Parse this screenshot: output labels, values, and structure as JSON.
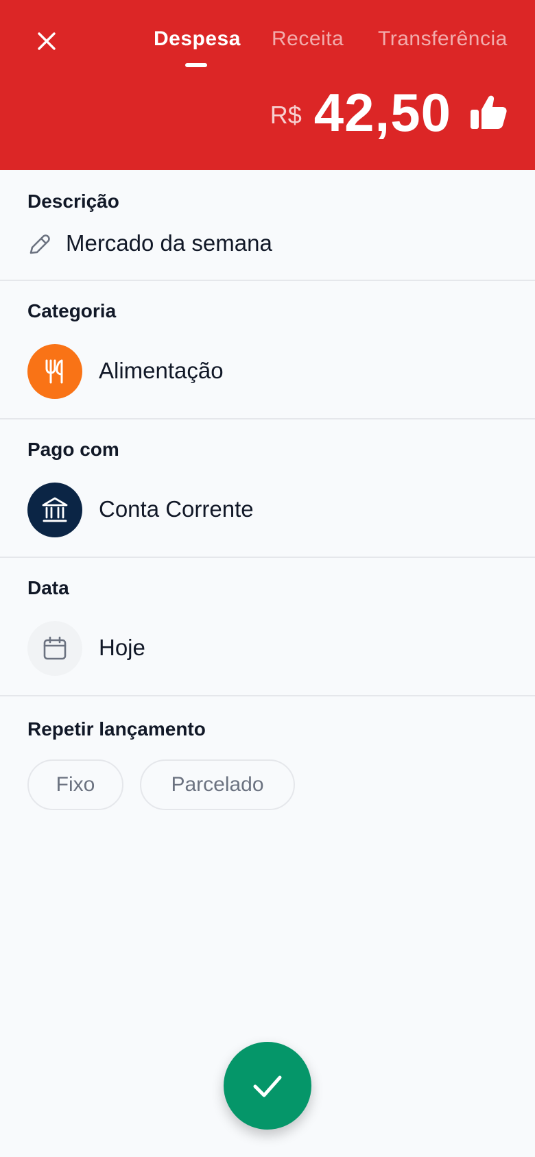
{
  "header": {
    "tabs": [
      {
        "label": "Despesa",
        "active": true
      },
      {
        "label": "Receita",
        "active": false
      },
      {
        "label": "Transferência",
        "active": false
      }
    ],
    "currency": "R$",
    "amount": "42,50"
  },
  "description": {
    "label": "Descrição",
    "value": "Mercado da semana"
  },
  "category": {
    "label": "Categoria",
    "value": "Alimentação",
    "icon": "fork-knife-icon",
    "color": "#f97316"
  },
  "paid_with": {
    "label": "Pago com",
    "value": "Conta Corrente",
    "icon": "bank-icon",
    "color": "#0b2545"
  },
  "date": {
    "label": "Data",
    "value": "Hoje",
    "icon": "calendar-icon"
  },
  "repeat": {
    "label": "Repetir lançamento",
    "options": [
      "Fixo",
      "Parcelado"
    ]
  },
  "colors": {
    "header": "#dc2626",
    "confirm": "#059669"
  }
}
